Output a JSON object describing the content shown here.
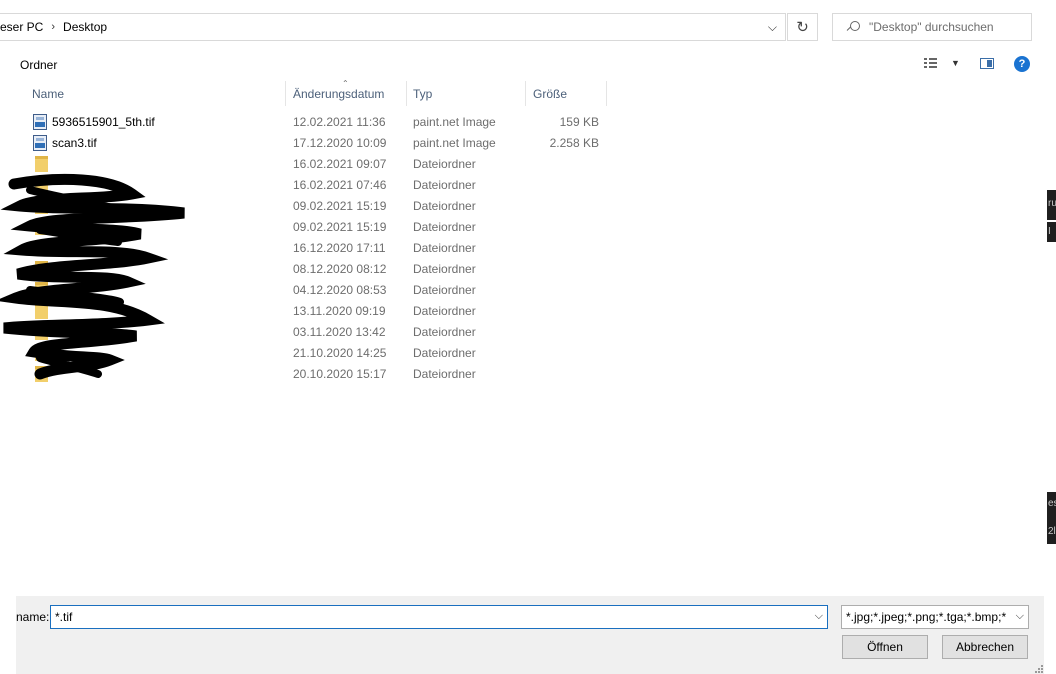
{
  "address": {
    "crumbs": [
      "eser PC",
      "Desktop"
    ],
    "separator_icon": "chevron-right-icon",
    "dropdown_icon": "chevron-down-icon",
    "refresh_icon": "↻"
  },
  "search": {
    "placeholder": "\"Desktop\" durchsuchen"
  },
  "toolbar": {
    "new_folder_label": "Ordner"
  },
  "columns": {
    "name": "Name",
    "date": "Änderungsdatum",
    "type": "Typ",
    "size": "Größe"
  },
  "files": [
    {
      "name": "5936515901_5th.tif",
      "date": "12.02.2021 11:36",
      "type": "paint.net Image",
      "size": "159 KB",
      "icon": "image-file-icon"
    },
    {
      "name": "scan3.tif",
      "date": "17.12.2020 10:09",
      "type": "paint.net Image",
      "size": "2.258 KB",
      "icon": "image-file-icon"
    },
    {
      "name": "",
      "date": "16.02.2021 09:07",
      "type": "Dateiordner",
      "size": "",
      "icon": "folder-icon"
    },
    {
      "name": "",
      "date": "16.02.2021 07:46",
      "type": "Dateiordner",
      "size": "",
      "icon": "folder-icon"
    },
    {
      "name": "",
      "date": "09.02.2021 15:19",
      "type": "Dateiordner",
      "size": "",
      "icon": "folder-icon"
    },
    {
      "name": "",
      "date": "09.02.2021 15:19",
      "type": "Dateiordner",
      "size": "",
      "icon": "folder-icon"
    },
    {
      "name": "",
      "date": "16.12.2020 17:11",
      "type": "Dateiordner",
      "size": "",
      "icon": "folder-icon"
    },
    {
      "name": "",
      "date": "08.12.2020 08:12",
      "type": "Dateiordner",
      "size": "",
      "icon": "folder-icon"
    },
    {
      "name": "",
      "date": "04.12.2020 08:53",
      "type": "Dateiordner",
      "size": "",
      "icon": "folder-icon"
    },
    {
      "name": "",
      "date": "13.11.2020 09:19",
      "type": "Dateiordner",
      "size": "",
      "icon": "folder-icon"
    },
    {
      "name": "",
      "date": "03.11.2020 13:42",
      "type": "Dateiordner",
      "size": "",
      "icon": "folder-icon"
    },
    {
      "name": "",
      "date": "21.10.2020 14:25",
      "type": "Dateiordner",
      "size": "",
      "icon": "folder-icon"
    },
    {
      "name": "",
      "date": "20.10.2020 15:17",
      "type": "Dateiordner",
      "size": "",
      "icon": "folder-icon"
    }
  ],
  "bottom": {
    "filename_label": "name:",
    "filename_value": "*.tif",
    "filter_value": "*.jpg;*.jpeg;*.png;*.tga;*.bmp;*",
    "open_label": "Öffnen",
    "cancel_label": "Abbrechen"
  },
  "edge_text": [
    "ru",
    "I",
    "es",
    "2l"
  ],
  "colors": {
    "accent": "#1a6fbf",
    "help": "#1a73d1",
    "header_text": "#4c607a",
    "muted_text": "#6d6d6d",
    "bottom_bg": "#f0f0f0"
  }
}
